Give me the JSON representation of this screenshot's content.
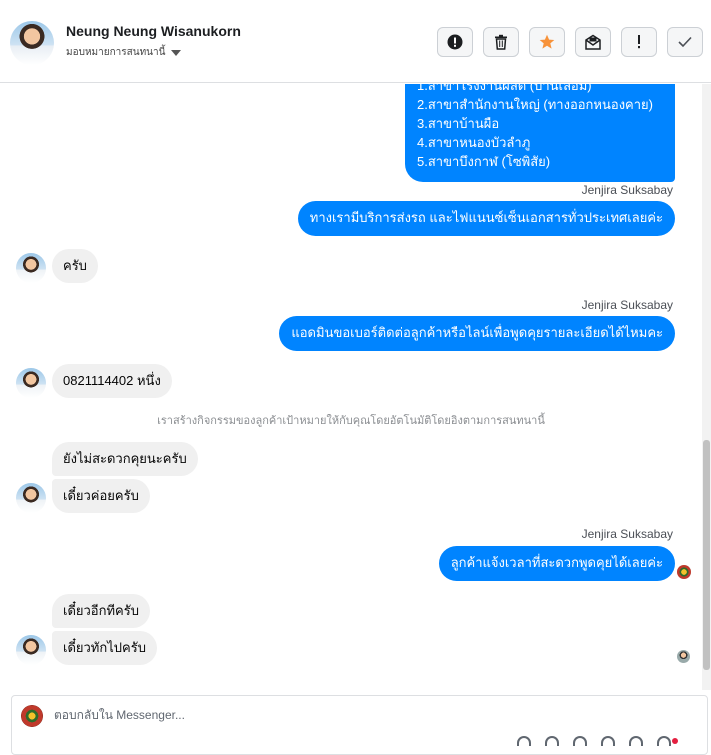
{
  "header": {
    "name": "Neung Neung Wisanukorn",
    "assign_label": "มอบหมายการสนทนานี้",
    "actions": [
      {
        "icon": "alert-circle-icon"
      },
      {
        "icon": "trash-icon"
      },
      {
        "icon": "star-icon"
      },
      {
        "icon": "mark-unread-icon"
      },
      {
        "icon": "exclamation-icon"
      },
      {
        "icon": "check-icon"
      }
    ]
  },
  "colors": {
    "outgoing_bubble": "#0084ff",
    "incoming_bubble": "#f0f0f0",
    "star": "#f7923a"
  },
  "messages": {
    "branch_list": [
      "1.สาขาโรงงานผลิต (บ้านเลื่อม)",
      "2.สาขาสำนักงานใหญ่ (ทางออกหนองคาย)",
      "3.สาขาบ้านผือ",
      "4.สาขาหนองบัวลำภู",
      "5.สาขาบึงกาฬ (โซพิสัย)"
    ],
    "sender_1": "Jenjira Suksabay",
    "out_1": "ทางเรามีบริการส่งรถ และไฟแนนซ์เซ็นเอกสารทั่วประเทศเลยค่ะ",
    "in_1": "ครับ",
    "sender_2": "Jenjira Suksabay",
    "out_2": "แอดมินขอเบอร์ติดต่อลูกค้าหรือไลน์เพื่อพูดคุยรายละเอียดได้ไหมคะ",
    "in_2": "0821114402 หนึ่ง",
    "system_note": "เราสร้างกิจกรรมของลูกค้าเป้าหมายให้กับคุณโดยอัตโนมัติโดยอิงตามการสนทนานี้",
    "in_3": "ยังไม่สะดวกคุยนะครับ",
    "in_4": "เดี๋ยวค่อยครับ",
    "sender_3": "Jenjira Suksabay",
    "out_3": "ลูกค้าแจ้งเวลาที่สะดวกพูดคุยได้เลยค่ะ",
    "in_5": "เดี๋ยวอีกทีครับ",
    "in_6": "เดี๋ยวทักไปครับ"
  },
  "composer": {
    "placeholder": "ตอบกลับใน Messenger..."
  }
}
